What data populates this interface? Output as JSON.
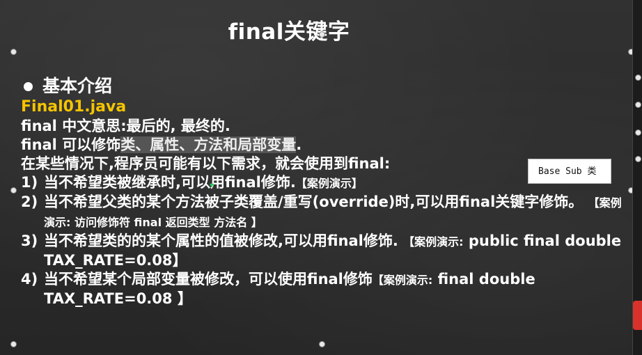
{
  "slide": {
    "title": "final关键字",
    "heading": "基本介绍",
    "file_name": "Final01.java",
    "line1": "final 中文意思:最后的, 最终的.",
    "line2_prefix": "final 可以修饰",
    "line2_highlight": "类、属性、方法和局部变量",
    "line2_suffix": ".",
    "line3": "在某些情况下,程序员可能有以下需求，就会使用到final:",
    "items": [
      {
        "num": "1)",
        "text": "当不希望类被继承时,可以用final修饰.",
        "demo": "【案例演示】"
      },
      {
        "num": "2)",
        "text": "当不希望父类的某个方法被子类覆盖/重写(override)时,可以用final关键字修饰。",
        "demo": "【案例演示: 访问修饰符 final 返回类型 方法名 】"
      },
      {
        "num": "3)",
        "text": "当不希望类的的某个属性的值被修改,可以用final修饰.",
        "demo_prefix": "【案例演示:",
        "demo_rest": " public final double TAX_RATE=0.08】"
      },
      {
        "num": "4)",
        "text": "当不希望某个局部变量被修改，可以使用final修饰",
        "demo_prefix": "【案例演示:",
        "demo_rest": " final double TAX_RATE=0.08 】"
      }
    ]
  },
  "tooltip": {
    "text": "Base Sub 类"
  },
  "colors": {
    "file_name": "#f5c400",
    "background": "#2b2b2b",
    "text": "#ffffff"
  },
  "icons": [
    "bullet-dot-icon",
    "cursor-icon",
    "app-icon"
  ]
}
